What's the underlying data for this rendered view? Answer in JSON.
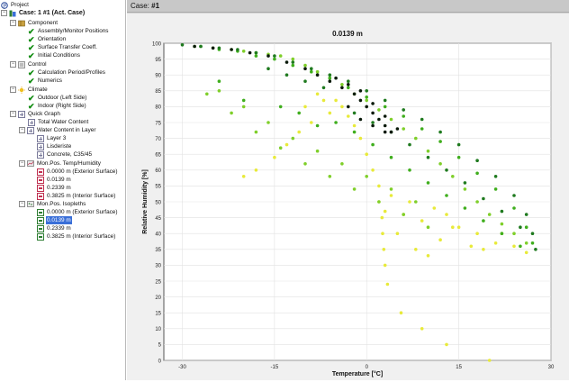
{
  "tree": {
    "project": "Project",
    "case": "Case: 1 #1 (Act. Case)",
    "component": "Component",
    "assembly": "Assembly/Monitor Positions",
    "orientation": "Orientation",
    "surface": "Surface Transfer Coeff.",
    "initial": "Initial Conditions",
    "control": "Control",
    "calc": "Calculation Period/Profiles",
    "numerics": "Numerics",
    "climate": "Climate",
    "outdoor": "Outdoor (Left Side)",
    "indoor": "Indoor (Right Side)",
    "quick": "Quick Graph",
    "total_water": "Total Water Content",
    "water_layer": "Water Content in Layer",
    "layer3": "Layer 3",
    "lasierste": "Lisderiste",
    "concrete": "Concrete, C35/45",
    "mon_temp": "Mon.Pos. Temp/Humidity",
    "mt1": "0.0000 m (Exterior Surface)",
    "mt2": "0.0139 m",
    "mt3": "0.2339 m",
    "mt4": "0.3825 m (Interior Surface)",
    "mon_iso": "Mon.Pos. Isopleths",
    "mi1": "0.0000 m (Exterior Surface)",
    "mi2": "0.0139 m",
    "mi3": "0.2339 m",
    "mi4": "0.3825 m (Interior Surface)"
  },
  "header": {
    "case_label": "Case:",
    "case_value": "#1"
  },
  "colors": {
    "dark_green": "#1f7a1f",
    "green": "#3fae1d",
    "light_green": "#7fcf2a",
    "yellow": "#e8ea3a",
    "black": "#0a1a0a",
    "selection": "#3a6fd8"
  },
  "icons": [
    "project-icon",
    "case-icon",
    "component-icon",
    "check-icon",
    "control-icon",
    "climate-icon",
    "quick-graph-icon",
    "chart-icon",
    "monitor-icon",
    "isopleth-icon"
  ],
  "chart_data": {
    "type": "scatter",
    "title": "0.0139 m",
    "xlabel": "Temperature [°C]",
    "ylabel": "Relative Humidity [%]",
    "xlim": [
      -33,
      30
    ],
    "ylim": [
      0,
      100
    ],
    "xticks": [
      "-30",
      "-15",
      "0",
      "15",
      "30"
    ],
    "yticks": [
      "0",
      "5",
      "10",
      "15",
      "20",
      "25",
      "30",
      "35",
      "40",
      "45",
      "50",
      "55",
      "60",
      "65",
      "70",
      "75",
      "80",
      "85",
      "90",
      "95",
      "100"
    ],
    "grid": true,
    "series": [
      {
        "color": "yellow",
        "values": [
          [
            -10,
            80
          ],
          [
            -8,
            84
          ],
          [
            -7,
            82
          ],
          [
            -6,
            78
          ],
          [
            -5,
            82
          ],
          [
            -4,
            80
          ],
          [
            -3,
            77
          ],
          [
            -2,
            74
          ],
          [
            -1,
            70
          ],
          [
            0,
            65
          ],
          [
            1,
            60
          ],
          [
            2,
            55
          ],
          [
            3,
            47
          ],
          [
            5,
            40
          ],
          [
            8,
            35
          ],
          [
            10,
            33
          ],
          [
            12,
            38
          ],
          [
            14,
            42
          ],
          [
            17,
            36
          ],
          [
            19,
            35
          ],
          [
            21,
            37
          ],
          [
            22,
            40
          ],
          [
            24,
            36
          ],
          [
            26,
            34
          ],
          [
            2,
            50
          ],
          [
            2.5,
            45
          ],
          [
            2.6,
            40
          ],
          [
            2.8,
            35
          ],
          [
            3,
            30
          ],
          [
            3.4,
            24
          ],
          [
            5.6,
            15
          ],
          [
            9,
            10
          ],
          [
            13,
            5
          ],
          [
            20,
            0
          ],
          [
            -9,
            75
          ],
          [
            -11,
            72
          ],
          [
            -13,
            68
          ],
          [
            -15,
            64
          ],
          [
            -18,
            60
          ],
          [
            -20,
            58
          ],
          [
            4,
            52
          ],
          [
            6,
            46
          ],
          [
            7,
            50
          ],
          [
            9,
            44
          ],
          [
            11,
            48
          ],
          [
            13,
            46
          ],
          [
            15,
            42
          ],
          [
            18,
            40
          ]
        ]
      },
      {
        "color": "light_green",
        "values": [
          [
            -28,
            99
          ],
          [
            -25,
            98.5
          ],
          [
            -22,
            98
          ],
          [
            -20,
            97.5
          ],
          [
            -18,
            97
          ],
          [
            -16,
            96.5
          ],
          [
            -14,
            96
          ],
          [
            -12,
            95
          ],
          [
            -10,
            93
          ],
          [
            -8,
            91
          ],
          [
            -6,
            89
          ],
          [
            -4,
            87
          ],
          [
            -2,
            84
          ],
          [
            0,
            82
          ],
          [
            2,
            79
          ],
          [
            4,
            76
          ],
          [
            6,
            73
          ],
          [
            8,
            70
          ],
          [
            10,
            66
          ],
          [
            12,
            62
          ],
          [
            14,
            58
          ],
          [
            16,
            54
          ],
          [
            18,
            50
          ],
          [
            20,
            46
          ],
          [
            22,
            43
          ],
          [
            24,
            40
          ],
          [
            26,
            37
          ],
          [
            -24,
            85
          ],
          [
            -20,
            80
          ],
          [
            -16,
            75
          ],
          [
            -12,
            70
          ],
          [
            -8,
            66
          ],
          [
            -4,
            62
          ],
          [
            0,
            58
          ],
          [
            4,
            54
          ],
          [
            8,
            50
          ],
          [
            -26,
            84
          ],
          [
            -22,
            78
          ],
          [
            -18,
            72
          ],
          [
            -14,
            67
          ],
          [
            -10,
            62
          ],
          [
            -6,
            58
          ],
          [
            -2,
            54
          ],
          [
            2,
            50
          ],
          [
            6,
            46
          ],
          [
            10,
            42
          ]
        ]
      },
      {
        "color": "green",
        "values": [
          [
            -27,
            99
          ],
          [
            -24,
            98
          ],
          [
            -21,
            97.5
          ],
          [
            -18,
            96
          ],
          [
            -15,
            95
          ],
          [
            -12,
            93
          ],
          [
            -9,
            91
          ],
          [
            -6,
            89
          ],
          [
            -3,
            86
          ],
          [
            0,
            83
          ],
          [
            3,
            80
          ],
          [
            6,
            77
          ],
          [
            9,
            73
          ],
          [
            12,
            69
          ],
          [
            15,
            64
          ],
          [
            18,
            59
          ],
          [
            21,
            54
          ],
          [
            24,
            48
          ],
          [
            26,
            42
          ],
          [
            27,
            37
          ],
          [
            -5,
            75
          ],
          [
            -2,
            72
          ],
          [
            1,
            68
          ],
          [
            4,
            64
          ],
          [
            7,
            60
          ],
          [
            10,
            56
          ],
          [
            13,
            52
          ],
          [
            16,
            48
          ],
          [
            19,
            44
          ],
          [
            22,
            40
          ],
          [
            25,
            36
          ],
          [
            -14,
            80
          ],
          [
            -11,
            78
          ],
          [
            -8,
            74
          ],
          [
            -20,
            82
          ],
          [
            -24,
            88
          ]
        ]
      },
      {
        "color": "dark_green",
        "values": [
          [
            -30,
            99.5
          ],
          [
            -27,
            99
          ],
          [
            -24,
            98.5
          ],
          [
            -21,
            98
          ],
          [
            -18,
            97
          ],
          [
            -15,
            96
          ],
          [
            -12,
            94
          ],
          [
            -9,
            92
          ],
          [
            -6,
            90
          ],
          [
            -3,
            88
          ],
          [
            0,
            85
          ],
          [
            3,
            82
          ],
          [
            6,
            79
          ],
          [
            9,
            76
          ],
          [
            12,
            72
          ],
          [
            15,
            68
          ],
          [
            18,
            63
          ],
          [
            21,
            58
          ],
          [
            24,
            52
          ],
          [
            26,
            46
          ],
          [
            27,
            40
          ],
          [
            27.5,
            35
          ],
          [
            -2,
            78
          ],
          [
            1,
            75
          ],
          [
            4,
            72
          ],
          [
            7,
            68
          ],
          [
            10,
            64
          ],
          [
            13,
            60
          ],
          [
            16,
            56
          ],
          [
            19,
            51
          ],
          [
            22,
            47
          ],
          [
            25,
            42
          ],
          [
            -16,
            92
          ],
          [
            -13,
            90
          ],
          [
            -10,
            88
          ],
          [
            -7,
            86
          ]
        ]
      },
      {
        "color": "black",
        "values": [
          [
            -28,
            99
          ],
          [
            -25,
            98.5
          ],
          [
            -22,
            98
          ],
          [
            -19,
            97
          ],
          [
            -16,
            96
          ],
          [
            -13,
            94
          ],
          [
            -10,
            92
          ],
          [
            -8,
            90
          ],
          [
            -6,
            88
          ],
          [
            -4,
            86
          ],
          [
            -2,
            84
          ],
          [
            -1,
            82
          ],
          [
            0,
            80
          ],
          [
            1,
            78
          ],
          [
            2,
            76
          ],
          [
            3,
            74
          ],
          [
            4,
            72
          ],
          [
            5,
            73
          ],
          [
            3,
            77
          ],
          [
            1,
            81
          ],
          [
            -1,
            85
          ],
          [
            -3,
            87
          ],
          [
            -5,
            89
          ],
          [
            -3,
            80
          ],
          [
            -1,
            76
          ],
          [
            1,
            74
          ],
          [
            3,
            72
          ]
        ]
      }
    ]
  }
}
